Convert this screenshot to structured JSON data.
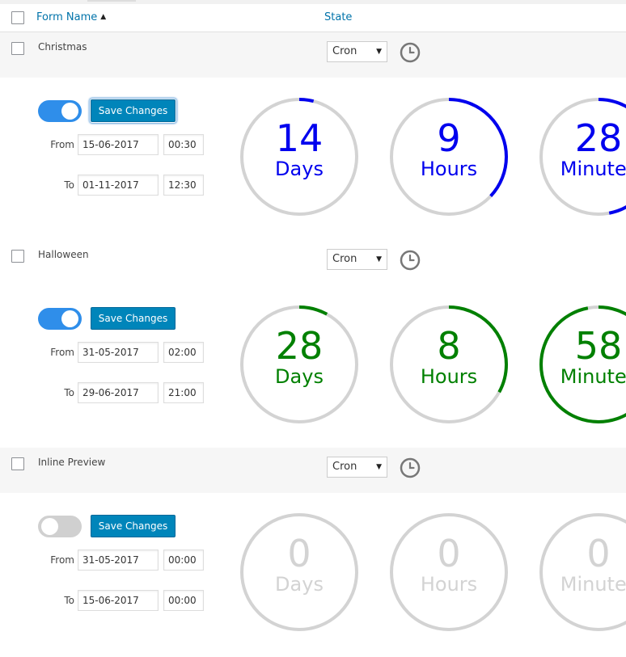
{
  "header": {
    "form_name_label": "Form Name",
    "sort_indicator": "▲",
    "state_label": "State"
  },
  "rows": [
    {
      "name": "Christmas",
      "state": "Cron",
      "enabled": true,
      "save_label": "Save Changes",
      "from_label": "From",
      "to_label": "To",
      "from_date": "15-06-2017",
      "from_time": "00:30",
      "to_date": "01-11-2017",
      "to_time": "12:30",
      "accent_color": "#0000ee",
      "countdown": [
        {
          "value": "14",
          "unit": "Days",
          "fraction": 0.04
        },
        {
          "value": "9",
          "unit": "Hours",
          "fraction": 0.37
        },
        {
          "value": "28",
          "unit": "Minutes",
          "fraction": 0.47
        }
      ]
    },
    {
      "name": "Halloween",
      "state": "Cron",
      "enabled": true,
      "save_label": "Save Changes",
      "from_label": "From",
      "to_label": "To",
      "from_date": "31-05-2017",
      "from_time": "02:00",
      "to_date": "29-06-2017",
      "to_time": "21:00",
      "accent_color": "#008000",
      "countdown": [
        {
          "value": "28",
          "unit": "Days",
          "fraction": 0.08
        },
        {
          "value": "8",
          "unit": "Hours",
          "fraction": 0.33
        },
        {
          "value": "58",
          "unit": "Minutes",
          "fraction": 0.97
        }
      ]
    },
    {
      "name": "Inline Preview",
      "state": "Cron",
      "enabled": false,
      "save_label": "Save Changes",
      "from_label": "From",
      "to_label": "To",
      "from_date": "31-05-2017",
      "from_time": "00:00",
      "to_date": "15-06-2017",
      "to_time": "00:00",
      "accent_color": "#d3d3d3",
      "countdown": [
        {
          "value": "0",
          "unit": "Days",
          "fraction": 0
        },
        {
          "value": "0",
          "unit": "Hours",
          "fraction": 0
        },
        {
          "value": "0",
          "unit": "Minutes",
          "fraction": 0
        }
      ]
    }
  ],
  "colors": {
    "link": "#0073aa",
    "button": "#0085ba",
    "toggle_on": "#2f8eea",
    "toggle_off": "#d0d0d0",
    "ring_track": "#d3d3d3"
  },
  "icons": {
    "state_schedule": "clock-icon",
    "select_arrow": "caret-down-icon"
  }
}
